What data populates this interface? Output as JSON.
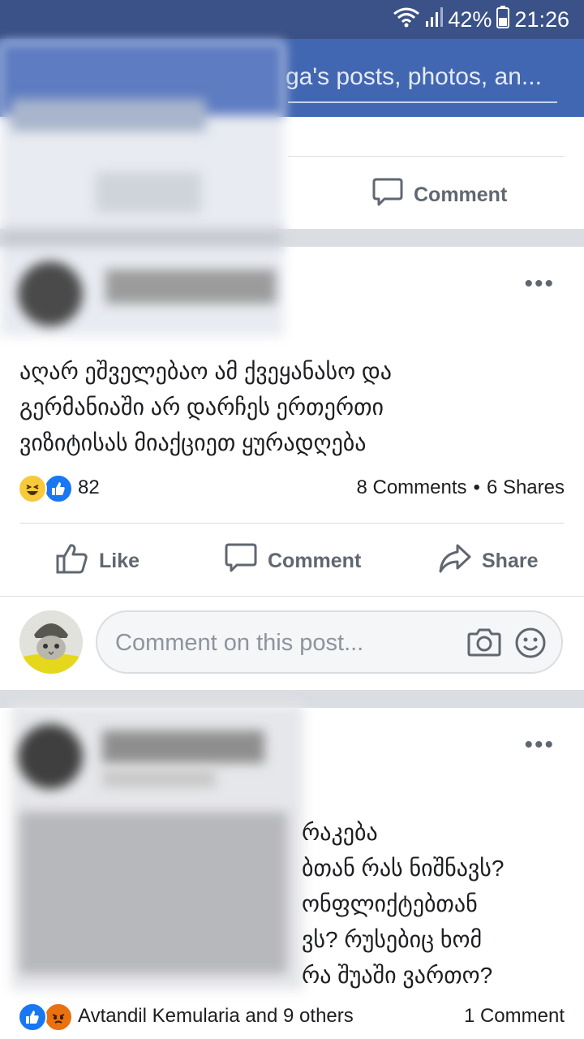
{
  "status_bar": {
    "battery": "42%",
    "time": "21:26"
  },
  "search": {
    "visible_text": "ga's posts, photos, an..."
  },
  "first_post": {
    "comment_label": "Comment"
  },
  "post": {
    "text_lines": [
      "აღარ ეშველებაო ამ ქვეყანასო და",
      "გერმანიაში არ დარჩეს ერთერთი",
      "ვიზიტისას მიაქციეთ ყურადღება"
    ],
    "reaction_count": "82",
    "comments": "8 Comments",
    "shares": "6 Shares",
    "separator": "•",
    "actions": {
      "like": "Like",
      "comment": "Comment",
      "share": "Share"
    },
    "comment_placeholder": "Comment on this post...",
    "more": "•••"
  },
  "next_post": {
    "text_lines": [
      "რაკება",
      "ბთან რას ნიშნავს?",
      "ონფლიქტებთან",
      "ვს? რუსებიც ხომ",
      "რა შუაში ვართო?"
    ],
    "reactors": "Avtandil Kemularia and 9 others",
    "comments": "1 Comment",
    "more": "•••"
  },
  "colors": {
    "status_bar": "#3b5288",
    "app_bar": "#4267b2",
    "like_blue": "#1877f2",
    "haha_yellow": "#f7c93b",
    "angry_red": "#e9710f"
  }
}
